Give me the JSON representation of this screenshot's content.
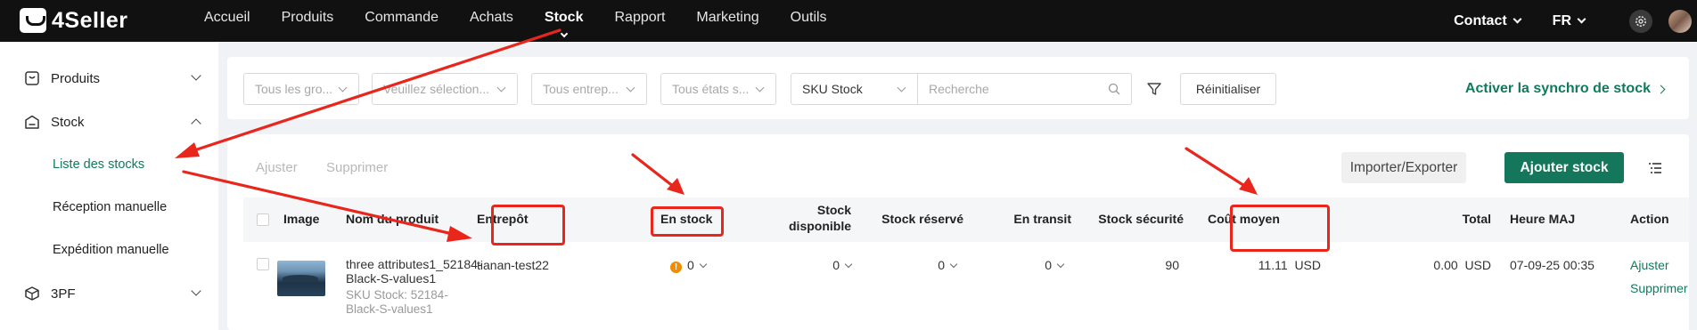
{
  "header": {
    "logo_text": "4Seller",
    "nav": [
      {
        "label": "Accueil",
        "active": false
      },
      {
        "label": "Produits",
        "active": false
      },
      {
        "label": "Commande",
        "active": false
      },
      {
        "label": "Achats",
        "active": false
      },
      {
        "label": "Stock",
        "active": true
      },
      {
        "label": "Rapport",
        "active": false
      },
      {
        "label": "Marketing",
        "active": false
      },
      {
        "label": "Outils",
        "active": false
      }
    ],
    "contact_label": "Contact",
    "lang_label": "FR",
    "settings_icon": "gear-icon",
    "avatar_icon": "user-avatar"
  },
  "sidebar": {
    "groups": [
      {
        "label": "Produits",
        "icon": "product-box-icon",
        "expanded": false
      },
      {
        "label": "Stock",
        "icon": "warehouse-icon",
        "expanded": true
      },
      {
        "label": "3PF",
        "icon": "package-icon",
        "expanded": false
      }
    ],
    "stock_items": [
      {
        "label": "Liste des stocks",
        "active": true
      },
      {
        "label": "Réception manuelle",
        "active": false
      },
      {
        "label": "Expédition manuelle",
        "active": false
      }
    ]
  },
  "filters": {
    "group_select": "Tous les gro...",
    "choose_select": "Veuillez sélection...",
    "warehouse_select": "Tous entrep...",
    "state_select": "Tous états s...",
    "search_field_select": "SKU Stock",
    "search_placeholder": "Recherche",
    "reset_label": "Réinitialiser",
    "sync_link": "Activer la synchro de stock"
  },
  "toolbar": {
    "adjust_label": "Ajuster",
    "delete_label": "Supprimer",
    "import_export_label": "Importer/Exporter",
    "add_stock_label": "Ajouter stock"
  },
  "table": {
    "columns": {
      "image": "Image",
      "product_name": "Nom du produit",
      "warehouse": "Entrepôt",
      "in_stock": "En stock",
      "available_line1": "Stock",
      "available_line2": "disponible",
      "reserved": "Stock réservé",
      "in_transit": "En transit",
      "safety": "Stock sécurité",
      "avg_cost": "Coût moyen",
      "total": "Total",
      "updated": "Heure MAJ",
      "action": "Action"
    },
    "rows": [
      {
        "name_line1": "three attributes1_52184-",
        "name_line2": "Black-S-values1",
        "sku_line1": "SKU Stock: 52184-",
        "sku_line2": "Black-S-values1",
        "warehouse": "tianan-test22",
        "warning": "!",
        "in_stock": "0",
        "available": "0",
        "reserved": "0",
        "in_transit": "0",
        "safety": "90",
        "avg_cost": "11.11",
        "avg_cost_currency": "USD",
        "total": "0.00",
        "total_currency": "USD",
        "updated": "07-09-25 00:35",
        "action_adjust": "Ajuster",
        "action_delete": "Supprimer"
      }
    ]
  },
  "colors": {
    "brand_green": "#14775c",
    "link_green": "#0f7a5d",
    "annotation_red": "#e8261c",
    "topbar_bg": "#111111",
    "warning_orange": "#f08c00"
  }
}
